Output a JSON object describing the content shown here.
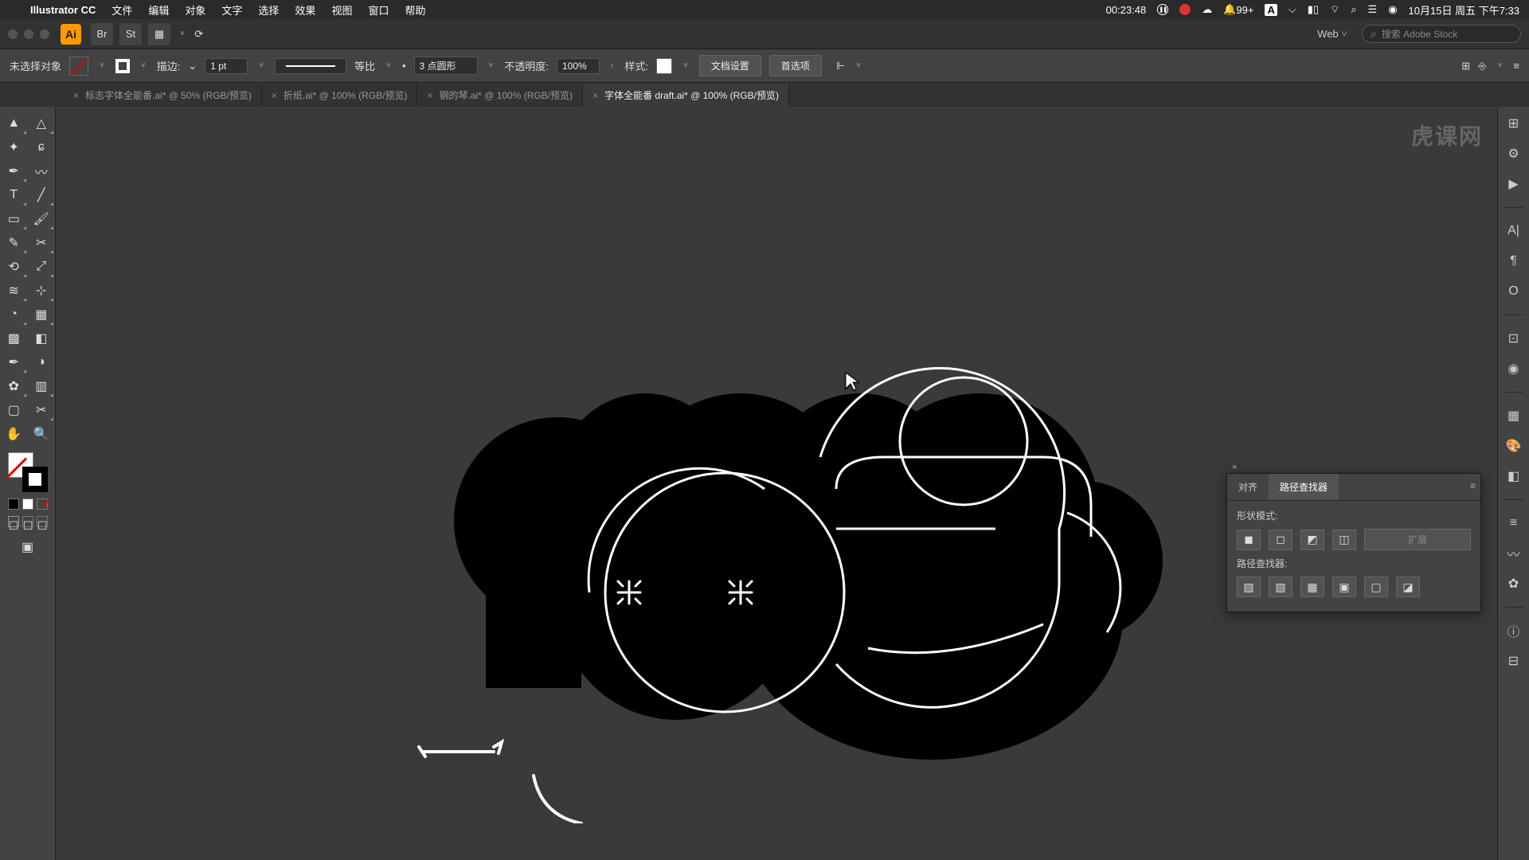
{
  "menubar": {
    "app": "Illustrator CC",
    "items": [
      "文件",
      "编辑",
      "对象",
      "文字",
      "选择",
      "效果",
      "视图",
      "窗口",
      "帮助"
    ],
    "timer": "00:23:48",
    "notif": "99+",
    "date": "10月15日 周五 下午7:33"
  },
  "header": {
    "profile": "Web",
    "search_placeholder": "搜索 Adobe Stock"
  },
  "control": {
    "selection": "未选择对象",
    "stroke_label": "描边:",
    "stroke_weight": "1 pt",
    "stroke_profile": "等比",
    "brush": "3 点圆形",
    "opacity_label": "不透明度:",
    "opacity": "100%",
    "style_label": "样式:",
    "doc_setup": "文档设置",
    "prefs": "首选项"
  },
  "tabs": [
    {
      "label": "标志字体全能番.ai* @ 50% (RGB/预览)",
      "active": false
    },
    {
      "label": "折纸.ai* @ 100% (RGB/预览)",
      "active": false
    },
    {
      "label": "钢的琴.ai* @ 100% (RGB/预览)",
      "active": false
    },
    {
      "label": "字体全能番 draft.ai* @ 100% (RGB/预览)",
      "active": true
    }
  ],
  "pathfinder": {
    "tab_align": "对齐",
    "tab_pathfinder": "路径查找器",
    "shape_modes": "形状模式:",
    "pathfinders": "路径查找器:",
    "expand": "扩展"
  },
  "watermark": "虎课网"
}
